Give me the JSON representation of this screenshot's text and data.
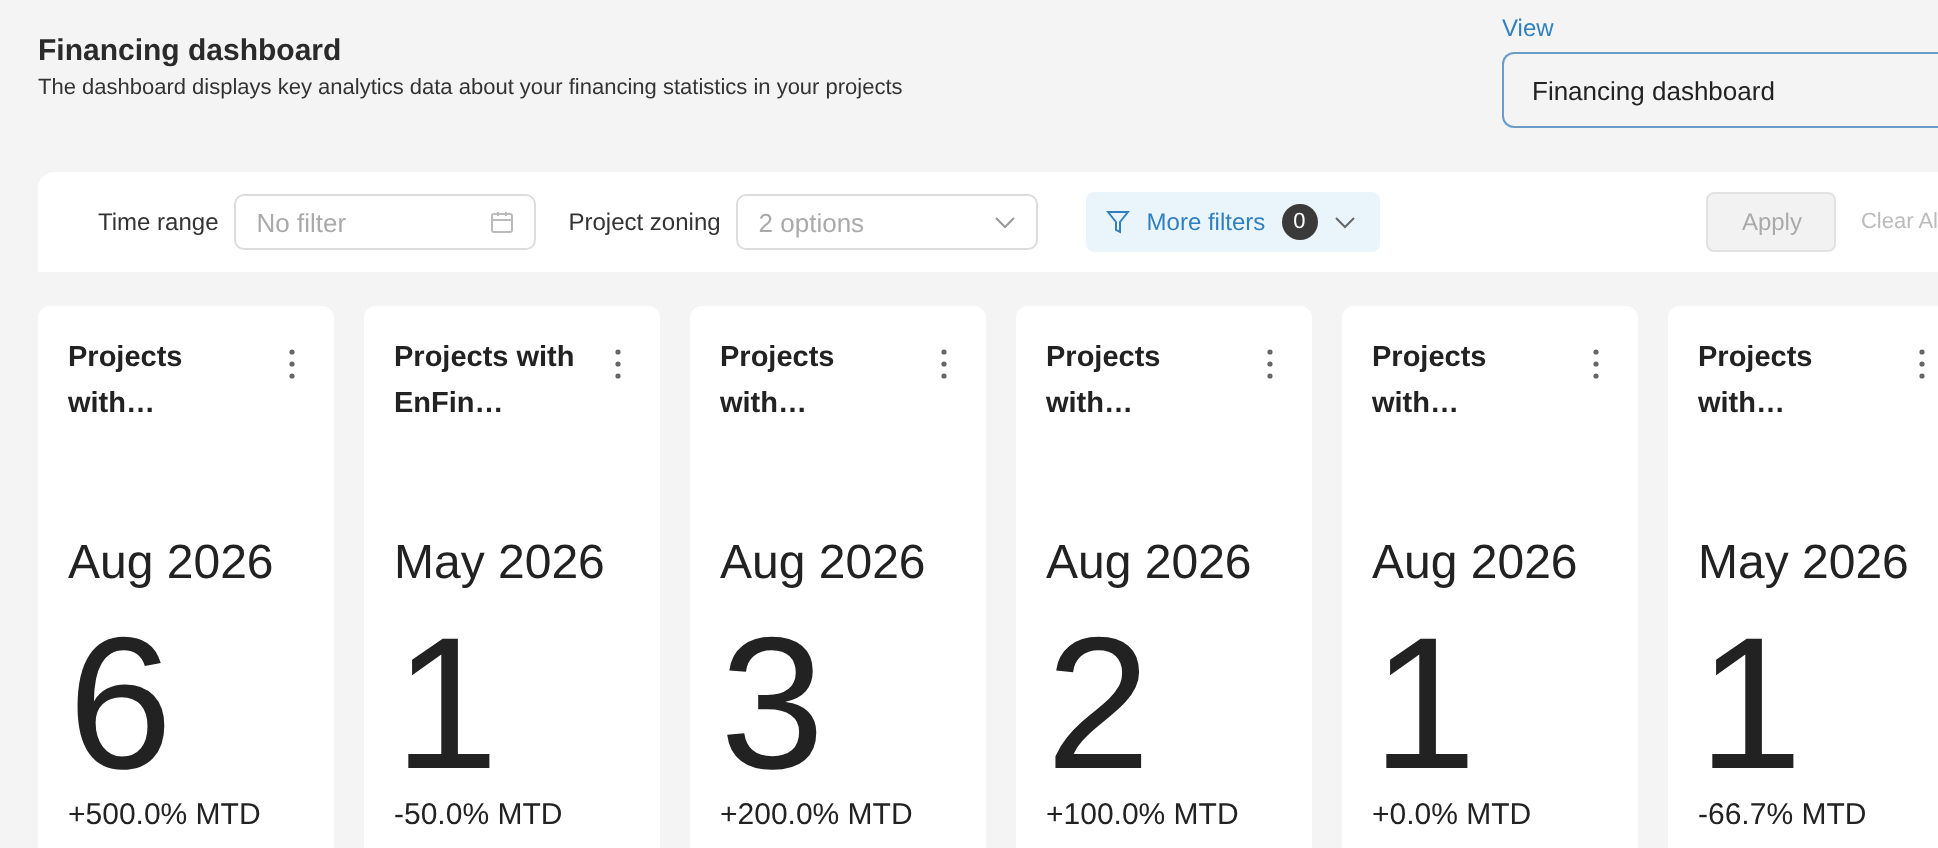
{
  "header": {
    "title": "Financing dashboard",
    "subtitle": "The dashboard displays key analytics data about your financing statistics in your projects"
  },
  "view": {
    "label": "View",
    "value": "Financing dashboard"
  },
  "filters": {
    "time_range": {
      "label": "Time range",
      "placeholder": "No filter"
    },
    "project_zoning": {
      "label": "Project zoning",
      "placeholder": "2 options"
    },
    "more_filters": {
      "label": "More filters",
      "count": "0"
    },
    "apply": {
      "label": "Apply",
      "disabled": true
    },
    "clear": {
      "label": "Clear Al"
    }
  },
  "cards": [
    {
      "title": "Projects with…",
      "period": "Aug 2026",
      "value": "6",
      "change": "+500.0% MTD"
    },
    {
      "title": "Projects with EnFin…",
      "period": "May 2026",
      "value": "1",
      "change": "-50.0% MTD"
    },
    {
      "title": "Projects with…",
      "period": "Aug 2026",
      "value": "3",
      "change": "+200.0% MTD"
    },
    {
      "title": "Projects with…",
      "period": "Aug 2026",
      "value": "2",
      "change": "+100.0% MTD"
    },
    {
      "title": "Projects with…",
      "period": "Aug 2026",
      "value": "1",
      "change": "+0.0% MTD"
    },
    {
      "title": "Projects with…",
      "period": "May 2026",
      "value": "1",
      "change": "-66.7% MTD"
    }
  ]
}
